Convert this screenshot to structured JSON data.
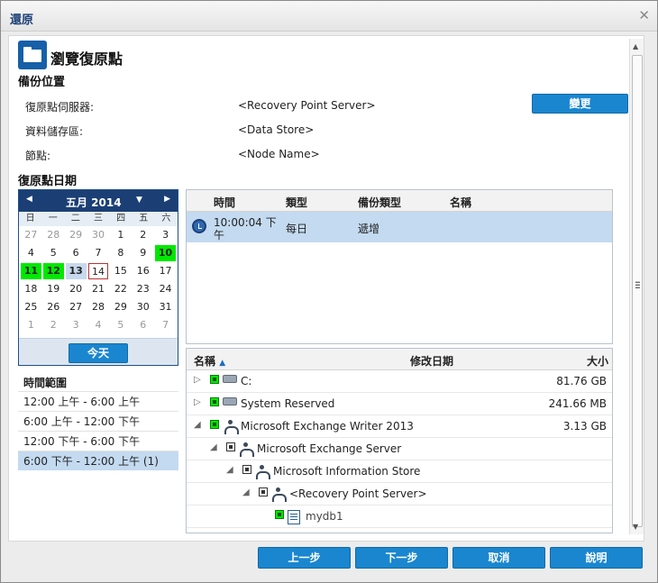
{
  "window": {
    "title": "還原"
  },
  "header": {
    "title": "瀏覽復原點"
  },
  "backup_location": {
    "section_title": "備份位置",
    "server_label": "復原點伺服器:",
    "server_value": "<Recovery Point Server>",
    "datastore_label": "資料儲存區:",
    "datastore_value": "<Data Store>",
    "node_label": "節點:",
    "node_value": "<Node Name>",
    "change_button": "變更"
  },
  "recovery_date": {
    "section_title": "復原點日期"
  },
  "calendar": {
    "month_label": "五月 2014",
    "dow": [
      "日",
      "一",
      "二",
      "三",
      "四",
      "五",
      "六"
    ],
    "weeks": [
      [
        {
          "d": "27",
          "c": "o"
        },
        {
          "d": "28",
          "c": "o"
        },
        {
          "d": "29",
          "c": "o"
        },
        {
          "d": "30",
          "c": "o"
        },
        {
          "d": "1",
          "c": ""
        },
        {
          "d": "2",
          "c": ""
        },
        {
          "d": "3",
          "c": ""
        }
      ],
      [
        {
          "d": "4",
          "c": ""
        },
        {
          "d": "5",
          "c": ""
        },
        {
          "d": "6",
          "c": ""
        },
        {
          "d": "7",
          "c": ""
        },
        {
          "d": "8",
          "c": ""
        },
        {
          "d": "9",
          "c": ""
        },
        {
          "d": "10",
          "c": "g"
        }
      ],
      [
        {
          "d": "11",
          "c": "g"
        },
        {
          "d": "12",
          "c": "g"
        },
        {
          "d": "13",
          "c": "sel"
        },
        {
          "d": "14",
          "c": "tod"
        },
        {
          "d": "15",
          "c": ""
        },
        {
          "d": "16",
          "c": ""
        },
        {
          "d": "17",
          "c": ""
        }
      ],
      [
        {
          "d": "18",
          "c": ""
        },
        {
          "d": "19",
          "c": ""
        },
        {
          "d": "20",
          "c": ""
        },
        {
          "d": "21",
          "c": ""
        },
        {
          "d": "22",
          "c": ""
        },
        {
          "d": "23",
          "c": ""
        },
        {
          "d": "24",
          "c": ""
        }
      ],
      [
        {
          "d": "25",
          "c": ""
        },
        {
          "d": "26",
          "c": ""
        },
        {
          "d": "27",
          "c": ""
        },
        {
          "d": "28",
          "c": ""
        },
        {
          "d": "29",
          "c": ""
        },
        {
          "d": "30",
          "c": ""
        },
        {
          "d": "31",
          "c": ""
        }
      ],
      [
        {
          "d": "1",
          "c": "o"
        },
        {
          "d": "2",
          "c": "o"
        },
        {
          "d": "3",
          "c": "o"
        },
        {
          "d": "4",
          "c": "o"
        },
        {
          "d": "5",
          "c": "o"
        },
        {
          "d": "6",
          "c": "o"
        },
        {
          "d": "7",
          "c": "o"
        }
      ]
    ],
    "today_button": "今天"
  },
  "time_range": {
    "title": "時間範圍",
    "items": [
      "12:00 上午 - 6:00 上午",
      "6:00 上午 - 12:00 下午",
      "12:00 下午 - 6:00 下午",
      "6:00 下午 - 12:00 上午   (1)"
    ]
  },
  "recovery_points": {
    "headers": {
      "time": "時間",
      "type": "類型",
      "backup_type": "備份類型",
      "name": "名稱"
    },
    "rows": [
      {
        "time_line1": "10:00:04 下",
        "time_line2": "午",
        "type": "每日",
        "backup_type": "遞增",
        "name": ""
      }
    ]
  },
  "tree": {
    "headers": {
      "name": "名稱",
      "modified": "修改日期",
      "size": "大小"
    },
    "sort_icon": "sort-ascending-icon",
    "rows": [
      {
        "label": "C:",
        "size": "81.76 GB"
      },
      {
        "label": "System Reserved",
        "size": "241.66 MB"
      },
      {
        "label": "Microsoft Exchange Writer 2013",
        "size": "3.13 GB"
      },
      {
        "label": "Microsoft Exchange Server",
        "size": ""
      },
      {
        "label": "Microsoft Information Store",
        "size": ""
      },
      {
        "label": "<Recovery Point Server>",
        "size": ""
      },
      {
        "label": "mydb1",
        "size": ""
      }
    ]
  },
  "footer": {
    "prev": "上一步",
    "next": "下一步",
    "cancel": "取消",
    "help": "說明"
  },
  "colors": {
    "accent": "#1a86cf",
    "header_blue": "#1b3f75",
    "selected_row": "#c3daf0",
    "available_date": "#00e800"
  }
}
